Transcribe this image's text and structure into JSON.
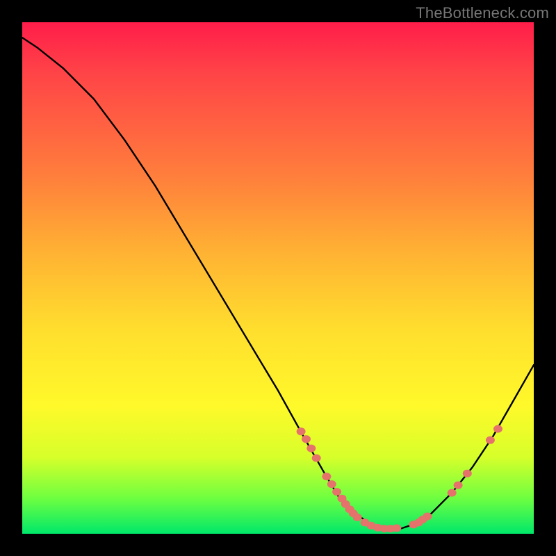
{
  "watermark": "TheBottleneck.com",
  "colors": {
    "background": "#000000",
    "gradient_top": "#ff1d4a",
    "gradient_mid1": "#ff7e3c",
    "gradient_mid2": "#ffde2e",
    "gradient_bottom": "#00e86a",
    "curve_stroke": "#000000",
    "marker_fill": "#e5726b"
  },
  "chart_data": {
    "type": "line",
    "title": "",
    "xlabel": "",
    "ylabel": "",
    "xlim": [
      0,
      100
    ],
    "ylim": [
      0,
      100
    ],
    "grid": false,
    "legend": false,
    "series": [
      {
        "name": "curve",
        "x": [
          0,
          3,
          8,
          14,
          20,
          26,
          32,
          38,
          44,
          50,
          55,
          59,
          62,
          65,
          68,
          71,
          74,
          77,
          80,
          84,
          88,
          92,
          96,
          100
        ],
        "y": [
          97,
          95,
          91,
          85,
          77,
          68,
          58,
          48,
          38,
          28,
          19,
          12,
          7,
          4,
          2,
          1,
          1,
          2,
          4,
          8,
          13,
          19,
          26,
          33
        ]
      }
    ],
    "markers": [
      {
        "x": 54.5,
        "y": 20.0
      },
      {
        "x": 55.5,
        "y": 18.5
      },
      {
        "x": 56.5,
        "y": 16.7
      },
      {
        "x": 57.5,
        "y": 14.8
      },
      {
        "x": 59.5,
        "y": 11.2
      },
      {
        "x": 60.5,
        "y": 9.7
      },
      {
        "x": 61.5,
        "y": 8.2
      },
      {
        "x": 62.5,
        "y": 6.9
      },
      {
        "x": 63.2,
        "y": 5.8
      },
      {
        "x": 64.0,
        "y": 4.8
      },
      {
        "x": 64.7,
        "y": 4.0
      },
      {
        "x": 65.5,
        "y": 3.2
      },
      {
        "x": 67.0,
        "y": 2.2
      },
      {
        "x": 68.2,
        "y": 1.6
      },
      {
        "x": 69.5,
        "y": 1.2
      },
      {
        "x": 70.8,
        "y": 1.0
      },
      {
        "x": 72.0,
        "y": 1.0
      },
      {
        "x": 73.2,
        "y": 1.1
      },
      {
        "x": 76.5,
        "y": 1.8
      },
      {
        "x": 77.5,
        "y": 2.2
      },
      {
        "x": 78.3,
        "y": 2.8
      },
      {
        "x": 79.2,
        "y": 3.4
      },
      {
        "x": 84.0,
        "y": 8.0
      },
      {
        "x": 85.2,
        "y": 9.5
      },
      {
        "x": 87.0,
        "y": 11.8
      },
      {
        "x": 91.5,
        "y": 18.3
      },
      {
        "x": 93.0,
        "y": 20.5
      }
    ]
  }
}
